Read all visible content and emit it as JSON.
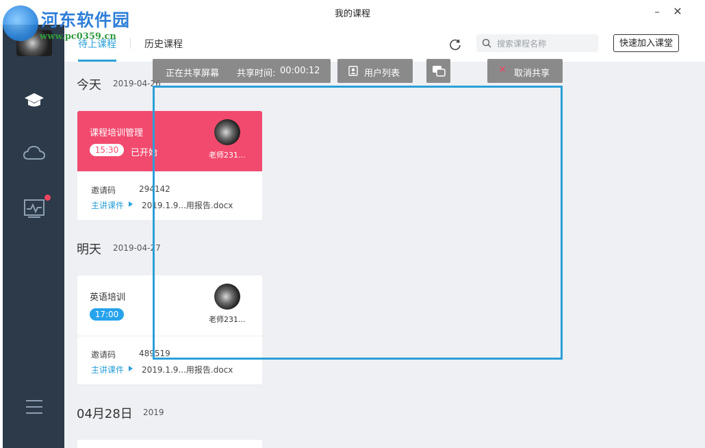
{
  "window": {
    "title": "我的课程",
    "minimize": "–",
    "close": "✕"
  },
  "watermark": {
    "text": "河东软件园",
    "url": "www.pc0359.cn"
  },
  "sidebar": {
    "items": [
      {
        "icon": "graduation-cap-icon"
      },
      {
        "icon": "cloud-icon"
      },
      {
        "icon": "activity-monitor-icon",
        "badge": true
      },
      {
        "icon": "menu-icon"
      }
    ]
  },
  "tabs": {
    "active": "待上课程",
    "history": "历史课程"
  },
  "search": {
    "placeholder": "搜索课程名称",
    "value": ""
  },
  "join_button": "快速加入课堂",
  "days": [
    {
      "heading": "今天",
      "date": "2019-04-26",
      "courses": [
        {
          "title": "课程培训管理",
          "time": "15:30",
          "status": "已开始",
          "teacher": "老师231...",
          "invite_label": "邀请码",
          "invite_code": "294142",
          "courseware_label": "主讲课件",
          "courseware_file": "2019.1.9...用报告.docx",
          "highlight": "#f24a6e"
        }
      ]
    },
    {
      "heading": "明天",
      "date": "2019-04-27",
      "courses": [
        {
          "title": "英语培训",
          "time": "17:00",
          "status": "",
          "teacher": "老师231...",
          "invite_label": "邀请码",
          "invite_code": "489519",
          "courseware_label": "主讲课件",
          "courseware_file": "2019.1.9...用报告.docx"
        }
      ]
    },
    {
      "heading": "04月28日",
      "date": "2019",
      "courses": []
    }
  ],
  "share_bar": {
    "status": "正在共享屏幕",
    "timer_label": "共享时间:",
    "timer_value": "00:00:12",
    "user_list": "用户列表",
    "cancel": "取消共享",
    "frame_color": "#2a9fd8"
  }
}
